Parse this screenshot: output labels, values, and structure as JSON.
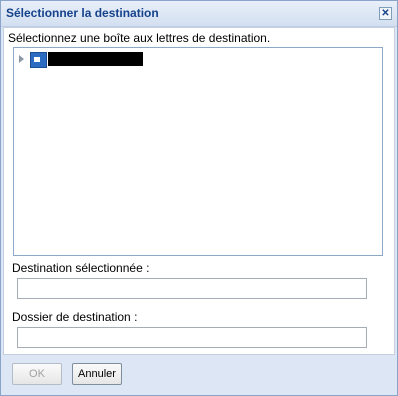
{
  "dialog": {
    "title": "Sélectionner la destination",
    "close_symbol": "✕"
  },
  "prompt": "Sélectionnez une boîte aux lettres de destination.",
  "tree": {
    "root": {
      "label": "",
      "icon": "mailbox-icon",
      "expander_icon": "expand-arrow-icon"
    }
  },
  "fields": {
    "selected_destination_label": "Destination sélectionnée :",
    "selected_destination_value": "",
    "destination_folder_label": "Dossier de destination :",
    "destination_folder_value": ""
  },
  "buttons": {
    "ok": "OK",
    "cancel": "Annuler"
  }
}
